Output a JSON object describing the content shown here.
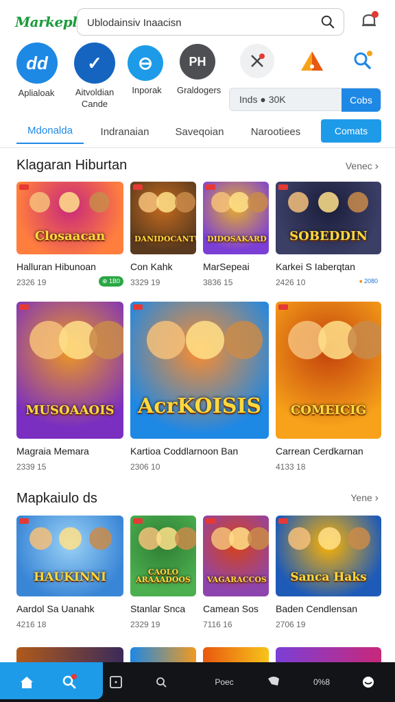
{
  "header": {
    "logo": "Markeplace",
    "search_value": "Ublodainsiv Inaacisn",
    "search_icon": "search-icon",
    "bell_icon": "bell-icon"
  },
  "apps": [
    {
      "label": "Aplialoak",
      "glyph": "dd",
      "color": "#1e88e5"
    },
    {
      "label": "Aitvoldian\nCande",
      "glyph": "✓",
      "color": "#1565c0"
    },
    {
      "label": "Inporak",
      "glyph": "⊖",
      "color": "#1e9be8"
    },
    {
      "label": "Graldogers",
      "glyph": "PH",
      "color": "#4d4f52"
    }
  ],
  "mini_icons": [
    "tools-icon",
    "cone-icon",
    "search-spark-icon"
  ],
  "counter": {
    "text": "Inds ● 30K",
    "button": "Cobs"
  },
  "tabs": [
    {
      "label": "Mdonalda",
      "active": true
    },
    {
      "label": "Indranaian",
      "active": false
    },
    {
      "label": "Saveqoian",
      "active": false
    },
    {
      "label": "Narootiees",
      "active": false
    }
  ],
  "tab_button": "Comats",
  "section1": {
    "title": "Klagaran Hiburtan",
    "see_all": "Venec",
    "row1": [
      {
        "thumb": "Closaacan",
        "name": "Halluran Hibunoan",
        "meta": "2326 19",
        "pill": "⊕ 1B0",
        "pill_type": "green",
        "colors": [
          "#ff7e3e",
          "#c8287a"
        ]
      },
      {
        "thumb": "DANIDOCANTUS",
        "name": "Con Kahk",
        "meta": "3329 19",
        "pill": "",
        "pill_type": "",
        "colors": [
          "#5a3a1e",
          "#c56b1e"
        ]
      },
      {
        "thumb": "DIDOSAKARD",
        "name": "MarSepeai",
        "meta": "3836 15",
        "pill": "",
        "pill_type": "",
        "colors": [
          "#7b3fd6",
          "#e8b02a"
        ]
      },
      {
        "thumb": "SOBEDDIN",
        "name": "Karkei S Iaberqtan",
        "meta": "2426 10",
        "pill": "2080",
        "pill_type": "orange",
        "colors": [
          "#3b3f66",
          "#1b1d3a"
        ]
      }
    ],
    "row2": [
      {
        "thumb": "MUSOAAOIS",
        "name": "Magraia Memara",
        "meta": "2339 15",
        "colors": [
          "#7a2fc0",
          "#f09a20"
        ]
      },
      {
        "thumb": "AcrKOISIS",
        "name": "Kartioa Coddlarnoon Ban",
        "meta": "2306 10",
        "colors": [
          "#1e88e5",
          "#ff8c2a"
        ]
      },
      {
        "thumb": "COMEICIG",
        "name": "Carrean Cerdkarnan",
        "meta": "4133 18",
        "colors": [
          "#f7a21a",
          "#c2410c"
        ]
      }
    ]
  },
  "section2": {
    "title": "Mapkaiulo ds",
    "see_all": "Yene",
    "row": [
      {
        "thumb": "HAUKINNI",
        "name": "Aardol Sa Uanahk",
        "meta": "4216 18",
        "colors": [
          "#3a86d6",
          "#9bd2f6"
        ]
      },
      {
        "thumb": "CAOLO ARAAADOOS",
        "name": "Stanlar Snca",
        "meta": "2329 19",
        "colors": [
          "#4caf50",
          "#2e7d32"
        ]
      },
      {
        "thumb": "VAGARACCOS",
        "name": "Camean Sos",
        "meta": "7116 16",
        "colors": [
          "#8e44ad",
          "#d84315"
        ]
      },
      {
        "thumb": "Sanca Haks",
        "name": "Baden Cendlensan",
        "meta": "2706 19",
        "colors": [
          "#1e5bb8",
          "#ffb300"
        ]
      }
    ]
  },
  "bottom_nav": [
    {
      "label": "home-icon"
    },
    {
      "label": "search-icon"
    },
    {
      "label": "board-icon"
    },
    {
      "label": "explore-icon"
    },
    {
      "label": "Poec"
    },
    {
      "label": "chat-icon"
    },
    {
      "label": "0%8"
    },
    {
      "label": "profile-icon"
    }
  ]
}
